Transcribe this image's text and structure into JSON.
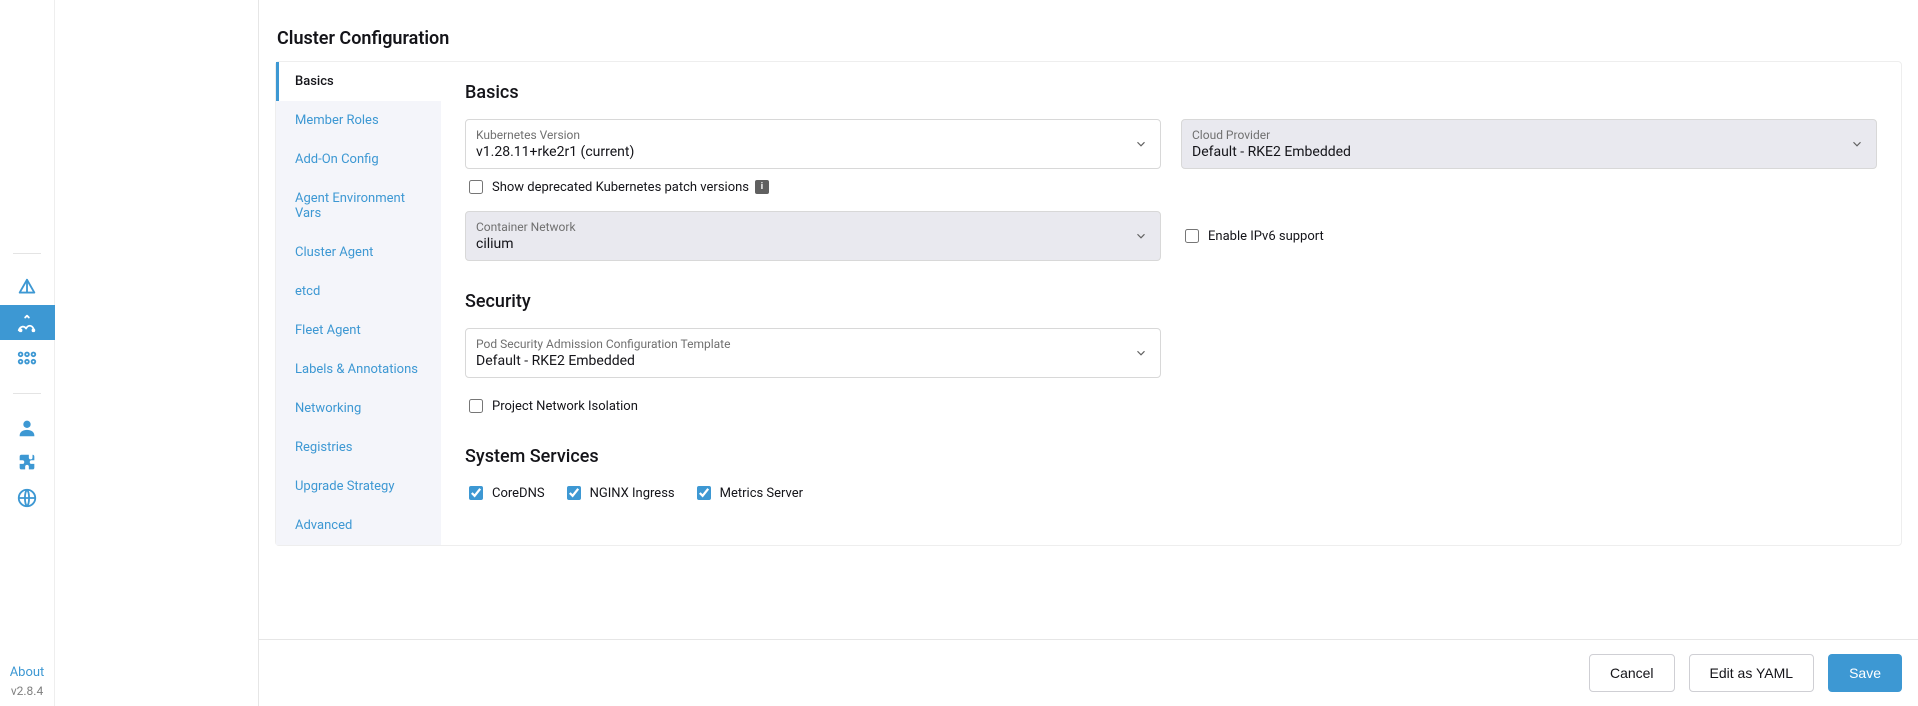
{
  "rail": {
    "about_label": "About",
    "version": "v2.8.4"
  },
  "page": {
    "title": "Cluster Configuration"
  },
  "tabs": [
    {
      "label": "Basics",
      "active": true
    },
    {
      "label": "Member Roles"
    },
    {
      "label": "Add-On Config"
    },
    {
      "label": "Agent Environment Vars"
    },
    {
      "label": "Cluster Agent"
    },
    {
      "label": "etcd"
    },
    {
      "label": "Fleet Agent"
    },
    {
      "label": "Labels & Annotations"
    },
    {
      "label": "Networking"
    },
    {
      "label": "Registries"
    },
    {
      "label": "Upgrade Strategy"
    },
    {
      "label": "Advanced"
    }
  ],
  "basics": {
    "heading": "Basics",
    "k8s_version": {
      "label": "Kubernetes Version",
      "value": "v1.28.11+rke2r1 (current)"
    },
    "show_deprecated_label": "Show deprecated Kubernetes patch versions",
    "cloud_provider": {
      "label": "Cloud Provider",
      "value": "Default - RKE2 Embedded"
    },
    "container_network": {
      "label": "Container Network",
      "value": "cilium"
    },
    "ipv6_label": "Enable IPv6 support"
  },
  "security": {
    "heading": "Security",
    "psa": {
      "label": "Pod Security Admission Configuration Template",
      "value": "Default - RKE2 Embedded"
    },
    "pni_label": "Project Network Isolation"
  },
  "system_services": {
    "heading": "System Services",
    "coredns": "CoreDNS",
    "nginx": "NGINX Ingress",
    "metrics": "Metrics Server"
  },
  "footer": {
    "cancel": "Cancel",
    "edit_yaml": "Edit as YAML",
    "save": "Save"
  }
}
